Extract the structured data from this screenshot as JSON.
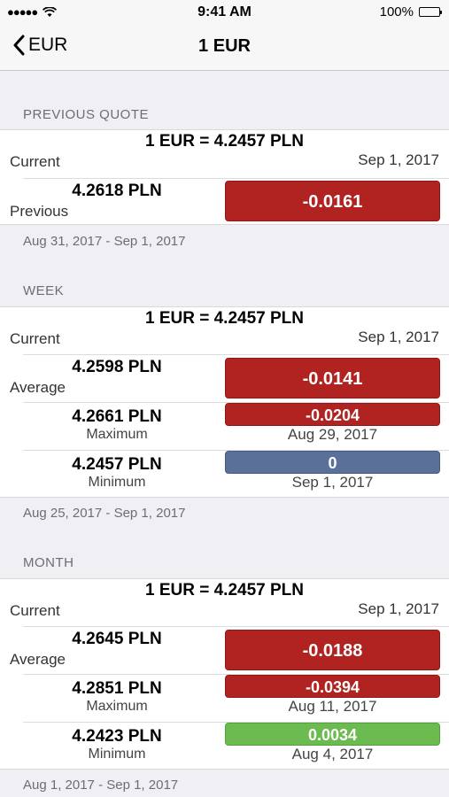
{
  "status": {
    "time": "9:41 AM",
    "battery": "100%"
  },
  "nav": {
    "back_label": "EUR",
    "title": "1 EUR"
  },
  "sections": {
    "previous": {
      "header": "PREVIOUS QUOTE",
      "rate": "1 EUR = 4.2457 PLN",
      "current_label": "Current",
      "current_date": "Sep 1, 2017",
      "prev_value": "4.2618 PLN",
      "prev_label": "Previous",
      "prev_change": "-0.0161",
      "footer": "Aug 31, 2017 - Sep 1, 2017"
    },
    "week": {
      "header": "WEEK",
      "rate": "1 EUR = 4.2457 PLN",
      "current_label": "Current",
      "current_date": "Sep 1, 2017",
      "avg_value": "4.2598 PLN",
      "avg_label": "Average",
      "avg_change": "-0.0141",
      "max_value": "4.2661 PLN",
      "max_label": "Maximum",
      "max_change": "-0.0204",
      "max_date": "Aug 29, 2017",
      "min_value": "4.2457 PLN",
      "min_label": "Minimum",
      "min_change": "0",
      "min_date": "Sep 1, 2017",
      "footer": "Aug 25, 2017 - Sep 1, 2017"
    },
    "month": {
      "header": "MONTH",
      "rate": "1 EUR = 4.2457 PLN",
      "current_label": "Current",
      "current_date": "Sep 1, 2017",
      "avg_value": "4.2645 PLN",
      "avg_label": "Average",
      "avg_change": "-0.0188",
      "max_value": "4.2851 PLN",
      "max_label": "Maximum",
      "max_change": "-0.0394",
      "max_date": "Aug 11, 2017",
      "min_value": "4.2423 PLN",
      "min_label": "Minimum",
      "min_change": "0.0034",
      "min_date": "Aug 4, 2017",
      "footer": "Aug 1, 2017 - Sep 1, 2017"
    }
  },
  "colors": {
    "negative": "#b02321",
    "neutral": "#5a7098",
    "positive": "#6bbb50"
  }
}
